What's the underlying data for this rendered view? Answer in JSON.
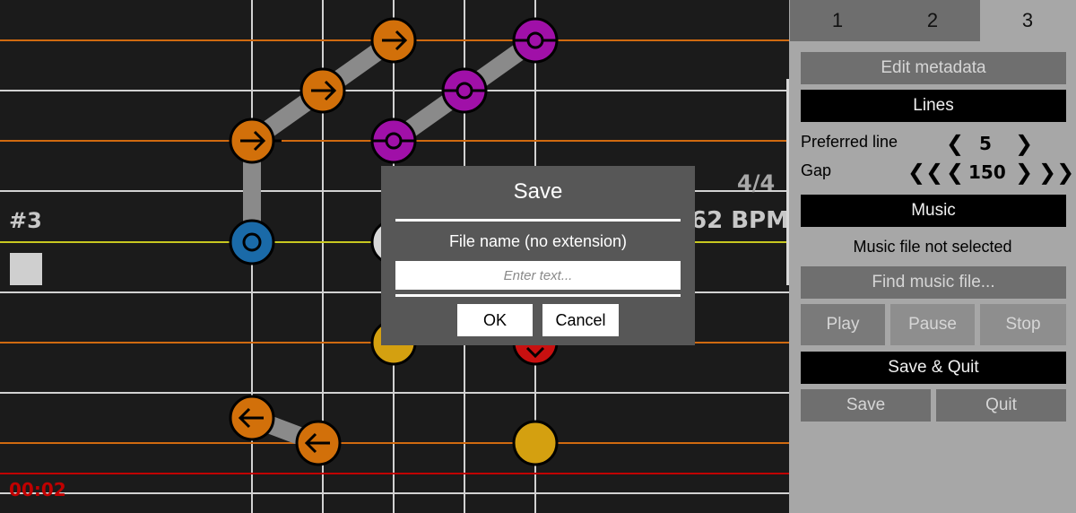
{
  "editor": {
    "measure_label": "#3",
    "time_signature": "4/4",
    "bpm": "62 BPM",
    "elapsed": "00:02",
    "colors": {
      "orange_line": "#d06a10",
      "white_line": "#d2d2d2",
      "yellow_line": "#c8c820",
      "red_line": "#c00000",
      "orange_note": "#d2700a",
      "purple_note": "#a010a8",
      "blue_note": "#1a6aa8",
      "yellow_note": "#d4a010",
      "red_note": "#c81010"
    }
  },
  "tabs": [
    {
      "label": "1"
    },
    {
      "label": "2"
    },
    {
      "label": "3"
    }
  ],
  "panel": {
    "edit_metadata": "Edit metadata",
    "lines_header": "Lines",
    "preferred_line_label": "Preferred line",
    "preferred_line_value": "5",
    "gap_label": "Gap",
    "gap_value": "150",
    "music_header": "Music",
    "music_status": "Music file not selected",
    "find_music": "Find music file...",
    "play": "Play",
    "pause": "Pause",
    "stop": "Stop",
    "save_quit": "Save & Quit",
    "save": "Save",
    "quit": "Quit",
    "chev_left": "❮",
    "chev_right": "❯",
    "chev_dbl_left": "❮❮",
    "chev_dbl_right": "❯❯"
  },
  "dialog": {
    "title": "Save",
    "field_label": "File name (no extension)",
    "placeholder": "Enter text...",
    "value": "",
    "ok": "OK",
    "cancel": "Cancel"
  }
}
